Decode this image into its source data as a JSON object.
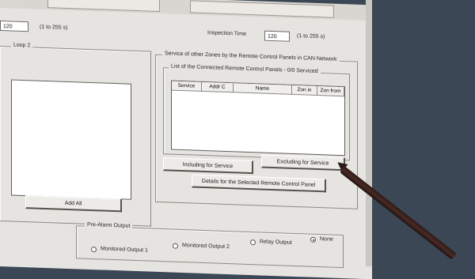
{
  "top_left": {
    "value": "120",
    "range": "(1 to 255 s)"
  },
  "inspection": {
    "label": "Inspection Time",
    "value": "120",
    "range": "(1 to 255 s)"
  },
  "loop2": {
    "title": "Loop 2",
    "add_all": "Add All"
  },
  "service": {
    "group_title": "Service of other Zones by the Remote Control Panels in CAN Network",
    "list_title": "List of the Connected Remote Control Panels - 0/0 Serviced",
    "columns": [
      "Service",
      "Addr C",
      "Name",
      "Zon in",
      "Zon from"
    ],
    "including": "Including for Service",
    "excluding": "Excluding for Service",
    "details": "Details for the Selected Remote Control Panel"
  },
  "prealarm": {
    "title": "Pre-Alarm Output",
    "options": [
      "Monitored Output 1",
      "Monitored Output 2",
      "Relay Output",
      "None"
    ],
    "selected": "None"
  }
}
